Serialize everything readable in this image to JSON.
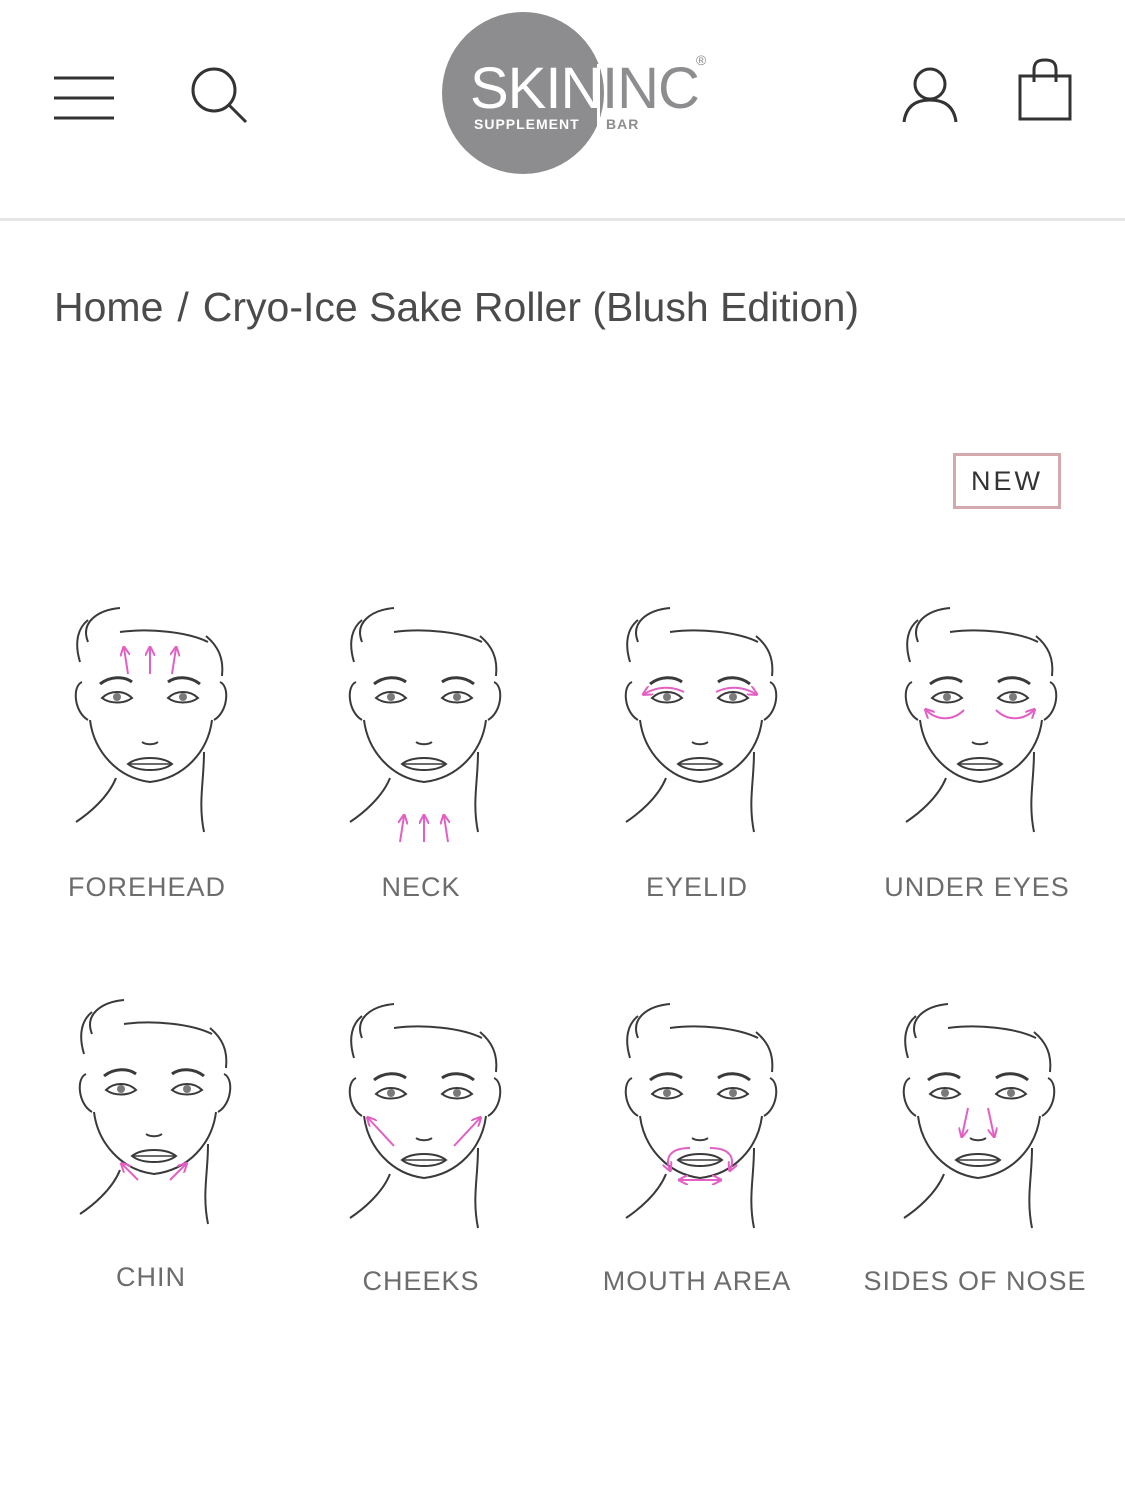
{
  "header": {
    "menu_icon": "hamburger-menu-icon",
    "search_icon": "search-icon",
    "account_icon": "user-account-icon",
    "cart_icon": "shopping-bag-icon",
    "logo": {
      "brand_left": "SKIN",
      "brand_right": "INC",
      "registered": "®",
      "sub_left": "SUPPLEMENT",
      "sub_right": "BAR"
    }
  },
  "breadcrumb": {
    "home": "Home",
    "separator": "/",
    "current": "Cryo-Ice Sake Roller (Blush Edition)"
  },
  "badge": {
    "label": "NEW"
  },
  "zones": [
    {
      "label": "FOREHEAD"
    },
    {
      "label": "NECK"
    },
    {
      "label": "EYELID"
    },
    {
      "label": "UNDER EYES"
    },
    {
      "label": "CHIN"
    },
    {
      "label": "CHEEKS"
    },
    {
      "label": "MOUTH AREA"
    },
    {
      "label": "SIDES OF NOSE"
    }
  ],
  "colors": {
    "arrow": "#e35fc4",
    "line_art": "#3a3a3a",
    "logo_grey": "#8d8d8f",
    "badge_border": "#d3a9ae"
  }
}
